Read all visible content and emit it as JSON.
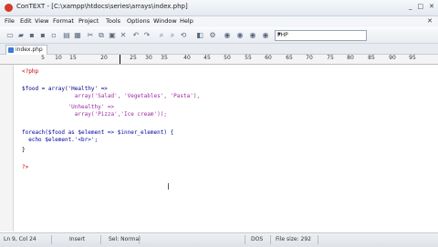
{
  "window": {
    "title": "ConTEXT - [C:\\xampp\\htdocs\\series\\arrays\\index.php]",
    "controls": [
      "_",
      "□",
      "✕"
    ]
  },
  "menu": {
    "items": [
      "File",
      "Edit",
      "View",
      "Format",
      "Project",
      "Tools",
      "Options",
      "Window",
      "Help"
    ],
    "close": "✕"
  },
  "toolbar": {
    "language": "PHP"
  },
  "tabs": [
    {
      "label": "index.php",
      "active": true
    }
  ],
  "ruler": {
    "numbers": [
      "5",
      "10",
      "15",
      "20",
      "25",
      "30",
      "35",
      "40",
      "45",
      "50",
      "55",
      "60",
      "65",
      "70",
      "75",
      "80",
      "85",
      "90",
      "95"
    ]
  },
  "code": {
    "lines": [
      "<?php",
      "",
      "$food = array('Healthy' =>",
      "                array('Salad', 'Vegetables', 'Pasta'),",
      "              'Unhealthy' =>",
      "                array('Pizza','Ice cream'));",
      "",
      "foreach($food as $element => $inner_element) {",
      "  echo $element.'<br>';",
      "}",
      "",
      "?>"
    ]
  },
  "status": {
    "position": "Ln 9, Col 24",
    "mode": "Insert",
    "selection": "Sel: Normal",
    "format": "DOS",
    "filesize": "File size: 292"
  },
  "colors": {
    "keyword": "#0000a0",
    "string": "#9a2aa0",
    "php_tag": "#c00000"
  }
}
